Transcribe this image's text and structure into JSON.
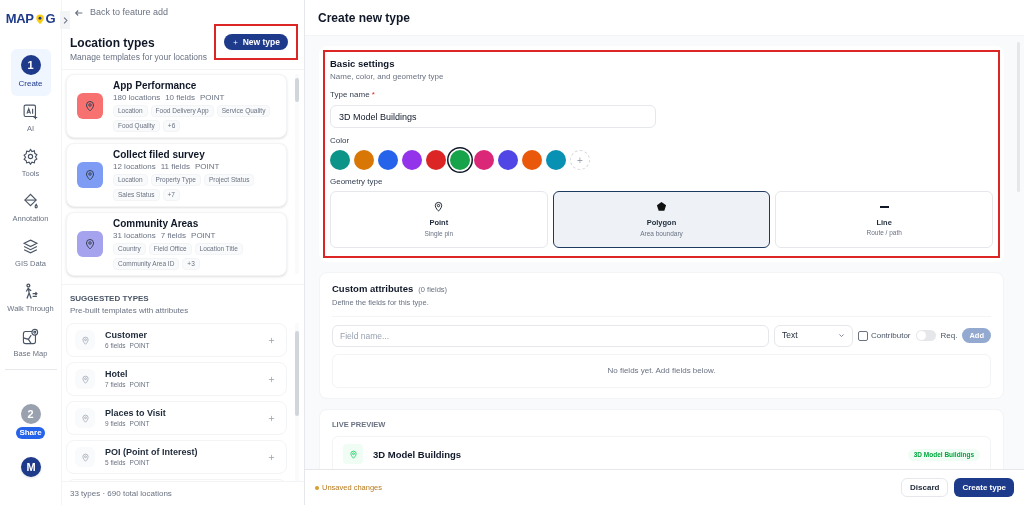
{
  "logo": {
    "before": "MAP",
    "after": "G"
  },
  "nav": [
    {
      "kind": "step",
      "number": "1",
      "label": "Create",
      "selected": true
    },
    {
      "kind": "tool",
      "label": "AI"
    },
    {
      "kind": "tool",
      "label": "Tools"
    },
    {
      "kind": "tool",
      "label": "Annotation"
    },
    {
      "kind": "tool",
      "label": "GIS Data"
    },
    {
      "kind": "tool",
      "label": "Walk Through"
    },
    {
      "kind": "tool",
      "label": "Base Map"
    },
    {
      "kind": "step",
      "number": "2",
      "label": "Share",
      "selected": false
    }
  ],
  "avatar": "M",
  "back_link": "Back to feature add",
  "panel": {
    "title": "Location types",
    "subtitle": "Manage templates for your locations",
    "new_button": {
      "label": "New type",
      "highlighted": true
    }
  },
  "location_types": [
    {
      "name": "App Performance",
      "locations": "180 locations",
      "fields": "10 fields",
      "geometry": "POINT",
      "color": "#f87171",
      "tags": [
        "Location",
        "Food Delivery App",
        "Service Quality",
        "Food Quality",
        "+6"
      ]
    },
    {
      "name": "Collect filed survey",
      "locations": "12 locations",
      "fields": "11 fields",
      "geometry": "POINT",
      "color": "#7f9cf5",
      "tags": [
        "Location",
        "Property Type",
        "Project Status",
        "Sales Status",
        "+7"
      ]
    },
    {
      "name": "Community Areas",
      "locations": "31 locations",
      "fields": "7 fields",
      "geometry": "POINT",
      "color": "#a5a3ee",
      "tags": [
        "Country",
        "Field Office",
        "Location Title",
        "Community Area ID",
        "+3"
      ]
    }
  ],
  "suggested": {
    "title": "SUGGESTED TYPES",
    "subtitle": "Pre-built templates with attributes",
    "items": [
      {
        "name": "Customer",
        "fields": "6 fields",
        "geometry": "POINT"
      },
      {
        "name": "Hotel",
        "fields": "7 fields",
        "geometry": "POINT"
      },
      {
        "name": "Places to Visit",
        "fields": "9 fields",
        "geometry": "POINT"
      },
      {
        "name": "POI (Point of Interest)",
        "fields": "5 fields",
        "geometry": "POINT"
      }
    ]
  },
  "panel_footer": "33 types · 690 total locations",
  "main_title": "Create new type",
  "basic": {
    "title": "Basic settings",
    "subtitle": "Name, color, and geometry type",
    "highlighted": true,
    "name_label": "Type name",
    "required_mark": "*",
    "name_value": "3D Model Buildings",
    "color_label": "Color",
    "colors": [
      {
        "color": "#0d9488",
        "selected": false
      },
      {
        "color": "#d97706",
        "selected": false
      },
      {
        "color": "#2563eb",
        "selected": false
      },
      {
        "color": "#9333ea",
        "selected": false
      },
      {
        "color": "#dc2626",
        "selected": false
      },
      {
        "color": "#16a34a",
        "selected": true
      },
      {
        "color": "#db2777",
        "selected": false
      },
      {
        "color": "#4f46e5",
        "selected": false
      },
      {
        "color": "#ea580c",
        "selected": false
      },
      {
        "color": "#0891b2",
        "selected": false
      }
    ],
    "add_color": "+",
    "geometry_label": "Geometry type",
    "geometry": [
      {
        "kind": "point",
        "label": "Point",
        "hint": "Single pin",
        "selected": false
      },
      {
        "kind": "polygon",
        "label": "Polygon",
        "hint": "Area boundary",
        "selected": true
      },
      {
        "kind": "line",
        "label": "Line",
        "hint": "Route / path",
        "selected": false
      }
    ]
  },
  "custom": {
    "title": "Custom attributes",
    "count": "(0 fields)",
    "subtitle": "Define the fields for this type.",
    "placeholder": "Field name...",
    "type_value": "Text",
    "contributor": {
      "label": "Contributor",
      "checked": false
    },
    "required": {
      "label": "Req.",
      "on": false
    },
    "add_button": {
      "label": "Add",
      "disabled": true
    },
    "empty": "No fields yet. Add fields below."
  },
  "preview": {
    "title": "LIVE PREVIEW",
    "name": "3D Model Buildings",
    "badge": "3D Model Buildings"
  },
  "footer": {
    "status": "Unsaved changes",
    "discard": "Discard",
    "create": "Create type"
  }
}
